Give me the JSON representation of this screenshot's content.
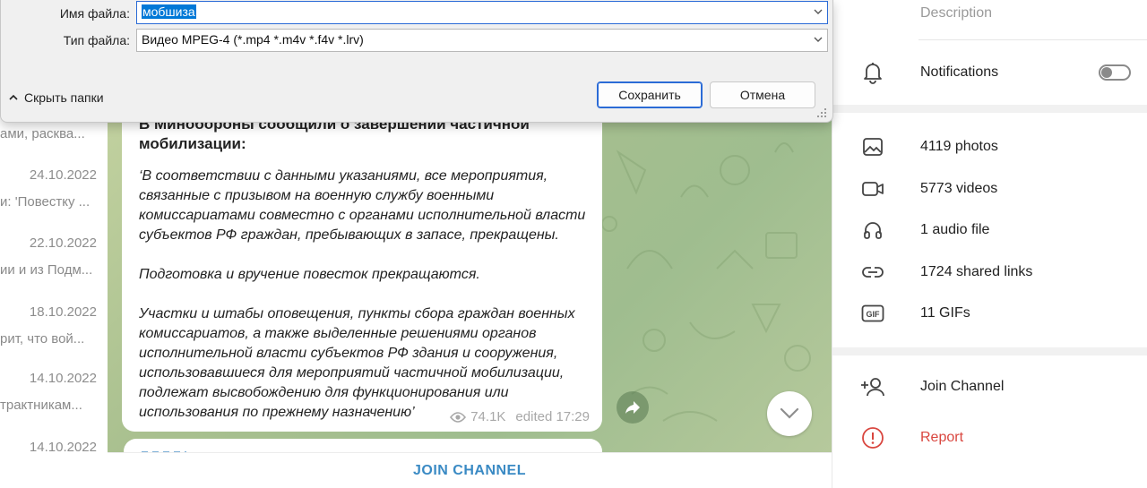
{
  "save_dialog": {
    "filename_label": "Имя файла:",
    "filename_value": "мобшиза",
    "filetype_label": "Тип файла:",
    "filetype_value": "Видео MPEG-4 (*.mp4 *.m4v *.f4v *.lrv)",
    "hide_folders_label": "Скрыть папки",
    "save_label": "Сохранить",
    "cancel_label": "Отмена"
  },
  "chat_list": {
    "items": [
      {
        "snippet": "ами, расква..."
      },
      {
        "date": "24.10.2022",
        "snippet": "и: 'Повестку ..."
      },
      {
        "date": "22.10.2022",
        "snippet": "ии и из Подм..."
      },
      {
        "date": "18.10.2022",
        "snippet": "рит, что вой..."
      },
      {
        "date": "14.10.2022",
        "snippet": "трактникам..."
      },
      {
        "date": "14.10.2022"
      }
    ]
  },
  "message": {
    "title_cut": "В Минобороны сообщили о завершении частичной",
    "title": "мобилизации:",
    "paragraphs": [
      "‘В соответствии с данными указаниями, все мероприятия, связанные с призывом на военную службу военными комиссариатами совместно с органами исполнительной власти субъектов РФ граждан, пребывающих в запасе, прекращены.",
      "Подготовка и вручение повесток прекращаются.",
      "Участки и штабы оповещения, пункты сбора граждан военных комиссариатов, а также выделенные решениями органов исполнительной власти субъектов РФ здания и сооружения, использовавшиеся для мероприятий частичной мобилизации, подлежат высвобождению для функционирования или использования по прежнему назначению’"
    ],
    "views": "74.1K",
    "edited": "edited 17:29"
  },
  "join_bar": {
    "label": "JOIN CHANNEL"
  },
  "right_panel": {
    "description_placeholder": "Description",
    "notifications_label": "Notifications",
    "notifications_enabled": false,
    "media": [
      {
        "icon": "photo-icon",
        "label": "4119 photos"
      },
      {
        "icon": "video-icon",
        "label": "5773 videos"
      },
      {
        "icon": "headphones-icon",
        "label": "1 audio file"
      },
      {
        "icon": "link-icon",
        "label": "1724 shared links"
      },
      {
        "icon": "gif-icon",
        "label": "11 GIFs"
      }
    ],
    "join_label": "Join Channel",
    "report_label": "Report"
  },
  "colors": {
    "accent": "#3a8ac4",
    "report": "#d9463f",
    "selection": "#0078d7"
  }
}
